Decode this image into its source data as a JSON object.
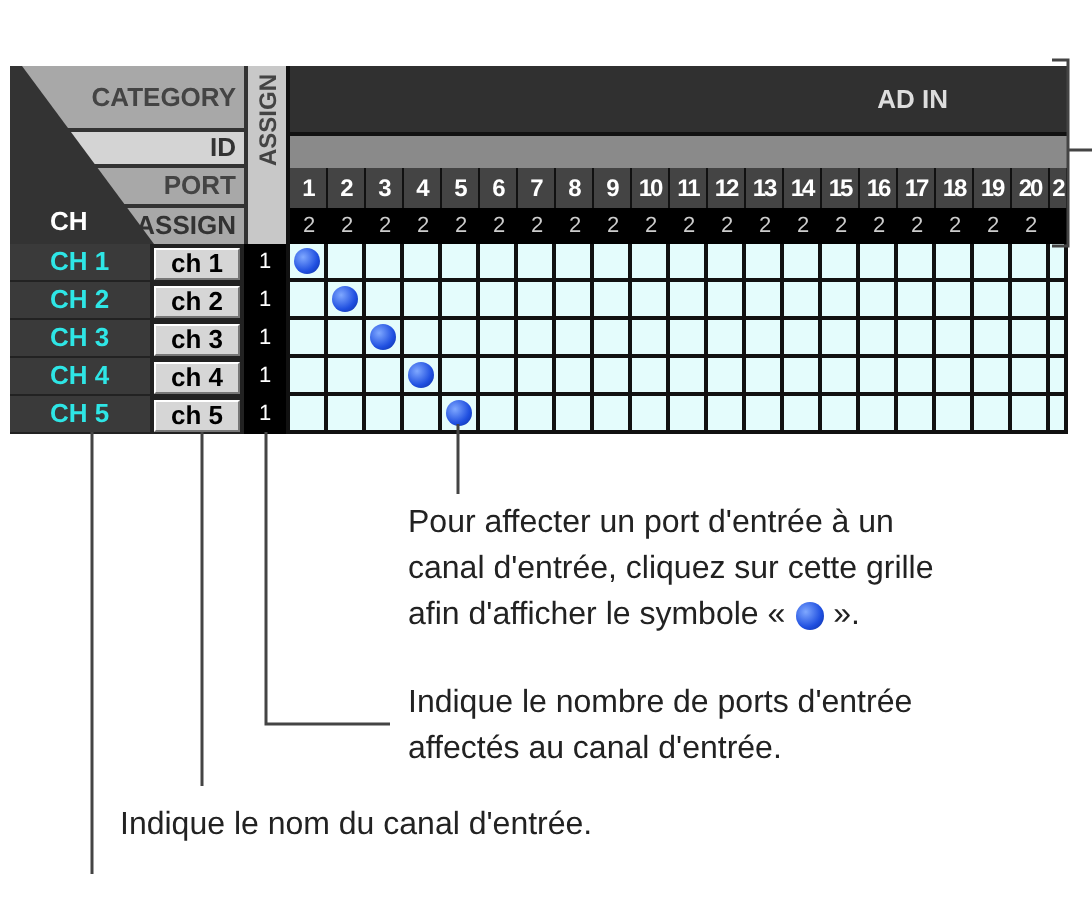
{
  "header": {
    "category_label": "CATEGORY",
    "id_label": "ID",
    "port_label": "PORT",
    "assign_label": "ASSIGN",
    "ch_label": "CH",
    "assign_column_label": "ASSIGN",
    "category": "AD IN"
  },
  "ports": [
    {
      "label": "1",
      "count": "2"
    },
    {
      "label": "2",
      "count": "2"
    },
    {
      "label": "3",
      "count": "2"
    },
    {
      "label": "4",
      "count": "2"
    },
    {
      "label": "5",
      "count": "2"
    },
    {
      "label": "6",
      "count": "2"
    },
    {
      "label": "7",
      "count": "2"
    },
    {
      "label": "8",
      "count": "2"
    },
    {
      "label": "9",
      "count": "2"
    },
    {
      "label": "10",
      "count": "2"
    },
    {
      "label": "11",
      "count": "2"
    },
    {
      "label": "12",
      "count": "2"
    },
    {
      "label": "13",
      "count": "2"
    },
    {
      "label": "14",
      "count": "2"
    },
    {
      "label": "15",
      "count": "2"
    },
    {
      "label": "16",
      "count": "2"
    },
    {
      "label": "17",
      "count": "2"
    },
    {
      "label": "18",
      "count": "2"
    },
    {
      "label": "19",
      "count": "2"
    },
    {
      "label": "20",
      "count": "2"
    },
    {
      "label": "2"
    }
  ],
  "channels": [
    {
      "ch": "CH 1",
      "name": "ch 1",
      "count": "1",
      "assigned": [
        true,
        false,
        false,
        false,
        false,
        false,
        false,
        false,
        false,
        false,
        false,
        false,
        false,
        false,
        false,
        false,
        false,
        false,
        false,
        false,
        false
      ]
    },
    {
      "ch": "CH 2",
      "name": "ch 2",
      "count": "1",
      "assigned": [
        false,
        true,
        false,
        false,
        false,
        false,
        false,
        false,
        false,
        false,
        false,
        false,
        false,
        false,
        false,
        false,
        false,
        false,
        false,
        false,
        false
      ]
    },
    {
      "ch": "CH 3",
      "name": "ch 3",
      "count": "1",
      "assigned": [
        false,
        false,
        true,
        false,
        false,
        false,
        false,
        false,
        false,
        false,
        false,
        false,
        false,
        false,
        false,
        false,
        false,
        false,
        false,
        false,
        false
      ]
    },
    {
      "ch": "CH 4",
      "name": "ch 4",
      "count": "1",
      "assigned": [
        false,
        false,
        false,
        true,
        false,
        false,
        false,
        false,
        false,
        false,
        false,
        false,
        false,
        false,
        false,
        false,
        false,
        false,
        false,
        false,
        false
      ]
    },
    {
      "ch": "CH 5",
      "name": "ch 5",
      "count": "1",
      "assigned": [
        false,
        false,
        false,
        false,
        true,
        false,
        false,
        false,
        false,
        false,
        false,
        false,
        false,
        false,
        false,
        false,
        false,
        false,
        false,
        false,
        false
      ]
    }
  ],
  "annotations": {
    "grid_note": {
      "lines": [
        "Pour affecter un port d'entrée à un",
        "canal d'entrée, cliquez sur cette grille",
        "afin d'afficher le symbole «"
      ],
      "suffix": "»."
    },
    "count_note": "Indique le nombre de ports d'entrée affectés au canal d'entrée.",
    "name_note": "Indique le nom du canal d'entrée."
  }
}
